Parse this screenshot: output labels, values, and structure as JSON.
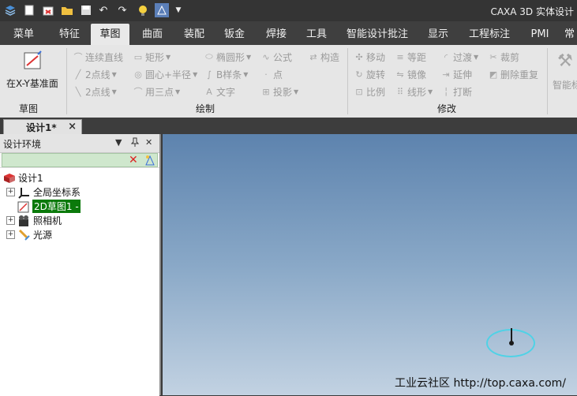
{
  "app": {
    "title": "CAXA 3D 实体设计"
  },
  "menu": [
    "菜单",
    "特征",
    "草图",
    "曲面",
    "装配",
    "钣金",
    "焊接",
    "工具",
    "智能设计批注",
    "显示",
    "工程标注",
    "PMI",
    "常"
  ],
  "ribbon": {
    "plane_button": "在X-Y基准面",
    "groups": {
      "sketch": "草图",
      "draw": "绘制",
      "modify": "修改"
    },
    "draw": {
      "polyline": "连续直线",
      "rect": "矩形",
      "ellipse": "椭圆形",
      "formula": "公式",
      "construct": "构造",
      "line2": "2点线",
      "circle": "圆心+半径",
      "bspline": "B样条",
      "point": "点",
      "tangent2": "2点线",
      "arc3": "用三点",
      "text": "文字",
      "project": "投影"
    },
    "modify": {
      "move": "移动",
      "offset": "等距",
      "fillet": "过渡",
      "trim": "裁剪",
      "rotate": "旋转",
      "mirror": "镜像",
      "extend": "延伸",
      "delete_overlap": "删除重复",
      "scale": "比例",
      "linear": "线形",
      "break": "打断"
    },
    "extra": "智能标"
  },
  "doc_tab": {
    "label": "设计1*",
    "close": "×"
  },
  "panel": {
    "title": "设计环境",
    "pin": "▼",
    "tree": [
      "设计1",
      "全局坐标系",
      "2D草图1 -",
      "照相机",
      "光源"
    ]
  },
  "viewport": {
    "watermark": "工业云社区 http://top.caxa.com/"
  }
}
